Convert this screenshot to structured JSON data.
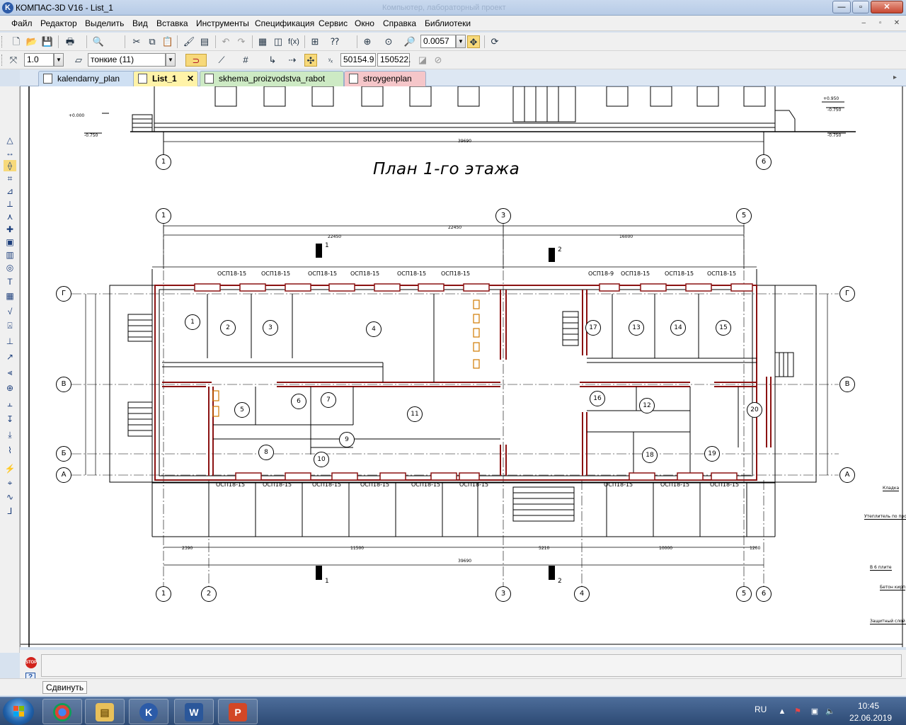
{
  "window": {
    "title": "КОМПАС-3D V16  -  List_1",
    "ghost_title": "Компьютер, лабораторный проект",
    "minimize_label": "—",
    "maximize_label": "▫",
    "close_label": "✕"
  },
  "menu": {
    "items": [
      "Файл",
      "Редактор",
      "Выделить",
      "Вид",
      "Вставка",
      "Инструменты",
      "Спецификация",
      "Сервис",
      "Окно",
      "Справка",
      "Библиотеки"
    ],
    "mdi": [
      "–",
      "▫",
      "✕"
    ]
  },
  "toolbar1": {
    "zoom_value": "0.0057"
  },
  "toolbar2": {
    "step_value": "1.0",
    "line_style": "тонкие (11)",
    "coord_x": "50154.9",
    "coord_y": "150522."
  },
  "tabs": [
    {
      "label": "kalendarny_plan",
      "color": "#cfe0f3",
      "active": false
    },
    {
      "label": "List_1",
      "color": "#fff3a8",
      "active": true,
      "close": "✕"
    },
    {
      "label": "skhema_proizvodstva_rabot",
      "color": "#cdeac4",
      "active": false
    },
    {
      "label": "stroygenplan",
      "color": "#f5c6c9",
      "active": false
    }
  ],
  "drawing": {
    "plan_title": "План 1-го этажа",
    "axis_labels_top": [
      "1",
      "6"
    ],
    "axis_labels_mid": [
      "1",
      "3",
      "5"
    ],
    "axis_labels_bottom": [
      "1",
      "2",
      "3",
      "4",
      "5",
      "6"
    ],
    "row_axes": [
      "Г",
      "В",
      "Б",
      "А"
    ],
    "section_marks": [
      "1",
      "2"
    ],
    "rooms": [
      "1",
      "2",
      "3",
      "4",
      "5",
      "6",
      "7",
      "8",
      "9",
      "10",
      "11",
      "12",
      "13",
      "14",
      "15",
      "16",
      "17",
      "18",
      "19",
      "20"
    ],
    "window_labels": [
      "ОСП18-15",
      "ОСП18-15",
      "ОСП18-15",
      "ОСП18-15",
      "ОСП18-15",
      "ОСП18-15",
      "ОСП18-9",
      "ОСП18-15",
      "ОСП18-15",
      "ОСП18-15"
    ],
    "dims_top": {
      "total": "22450",
      "left": "22450",
      "right": "16000"
    },
    "dims_bottom": {
      "seg1": "2390",
      "seg2": "11500",
      "seg3": "5210",
      "seg4": "10000",
      "seg5": "1200",
      "total": "39690"
    },
    "top_elev_left": "+0.000",
    "top_elev_left2": "-0.750",
    "top_elev_right": "+0.950",
    "top_elev_right2": "-0.750",
    "top_elev_right3": "-0.750",
    "margin_notes": [
      "Кладка",
      "Утеплитель по проекту",
      "В 6 плите",
      "Бетон кирп",
      "Защитный слой бетона"
    ]
  },
  "command": {
    "hint": "Сдвинуть"
  },
  "taskbar": {
    "apps": [
      "chrome",
      "explorer",
      "kompas",
      "word",
      "powerpoint"
    ],
    "lang": "RU",
    "time": "10:45",
    "date": "22.06.2019"
  }
}
